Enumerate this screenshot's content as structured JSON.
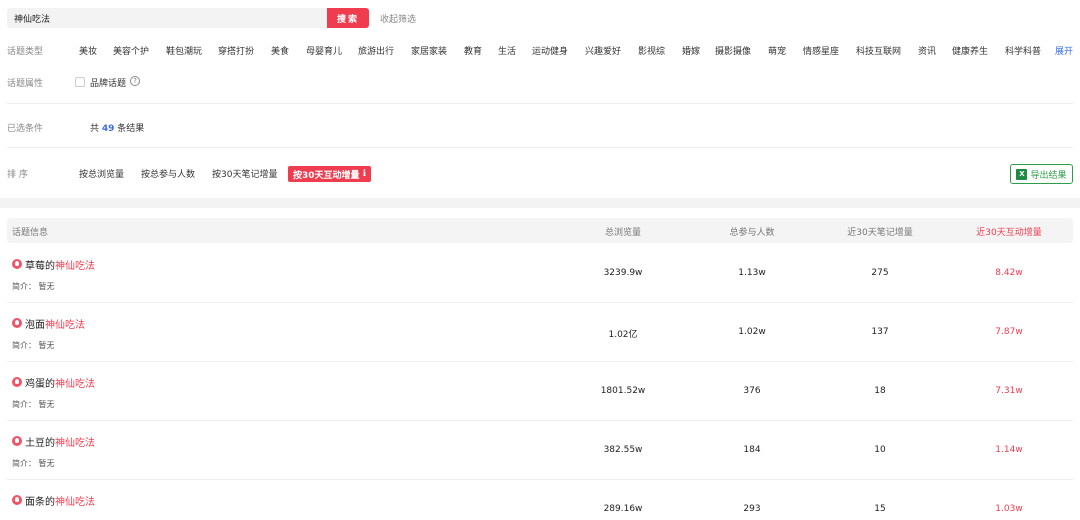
{
  "search": {
    "value": "神仙吃法",
    "button": "搜索",
    "collapse": "收起筛选"
  },
  "filters": {
    "type_label": "话题类型",
    "types": [
      "美妆",
      "美容个护",
      "鞋包潮玩",
      "穿搭打扮",
      "美食",
      "母婴育儿",
      "旅游出行",
      "家居家装",
      "教育",
      "生活",
      "运动健身",
      "兴趣爱好",
      "影视综",
      "婚嫁",
      "摄影摄像",
      "萌宠",
      "情感星座",
      "科技互联网",
      "资讯",
      "健康养生",
      "科学科普"
    ],
    "expand": "展开",
    "attr_label": "话题属性",
    "attr_option": "品牌话题",
    "selected_label": "已选条件",
    "result_prefix": "共",
    "result_count": "49",
    "result_suffix": "条结果"
  },
  "sort": {
    "label": "排 序",
    "options": [
      "按总浏览量",
      "按总参与人数",
      "按30天笔记增量"
    ],
    "active": "按30天互动增量",
    "active_icon": "ℹ",
    "export": "导出结果"
  },
  "table": {
    "headers": [
      "话题信息",
      "总浏览量",
      "总参与人数",
      "近30天笔记增量",
      "近30天互动增量"
    ],
    "desc_label": "简介：",
    "rows": [
      {
        "prefix": "草莓的",
        "highlight": "神仙吃法",
        "desc": "暂无",
        "views": "3239.9w",
        "participants": "1.13w",
        "notes": "275",
        "interactions": "8.42w"
      },
      {
        "prefix": "泡面",
        "highlight": "神仙吃法",
        "desc": "暂无",
        "views": "1.02亿",
        "participants": "1.02w",
        "notes": "137",
        "interactions": "7.87w"
      },
      {
        "prefix": "鸡蛋的",
        "highlight": "神仙吃法",
        "desc": "暂无",
        "views": "1801.52w",
        "participants": "376",
        "notes": "18",
        "interactions": "7.31w"
      },
      {
        "prefix": "土豆的",
        "highlight": "神仙吃法",
        "desc": "暂无",
        "views": "382.55w",
        "participants": "184",
        "notes": "10",
        "interactions": "1.14w"
      },
      {
        "prefix": "面条的",
        "highlight": "神仙吃法",
        "desc": "",
        "views": "289.16w",
        "participants": "293",
        "notes": "15",
        "interactions": "1.03w"
      }
    ]
  },
  "colors": {
    "accent": "#f03c4f",
    "link": "#3a6fe8",
    "export": "#2e9d4a"
  }
}
